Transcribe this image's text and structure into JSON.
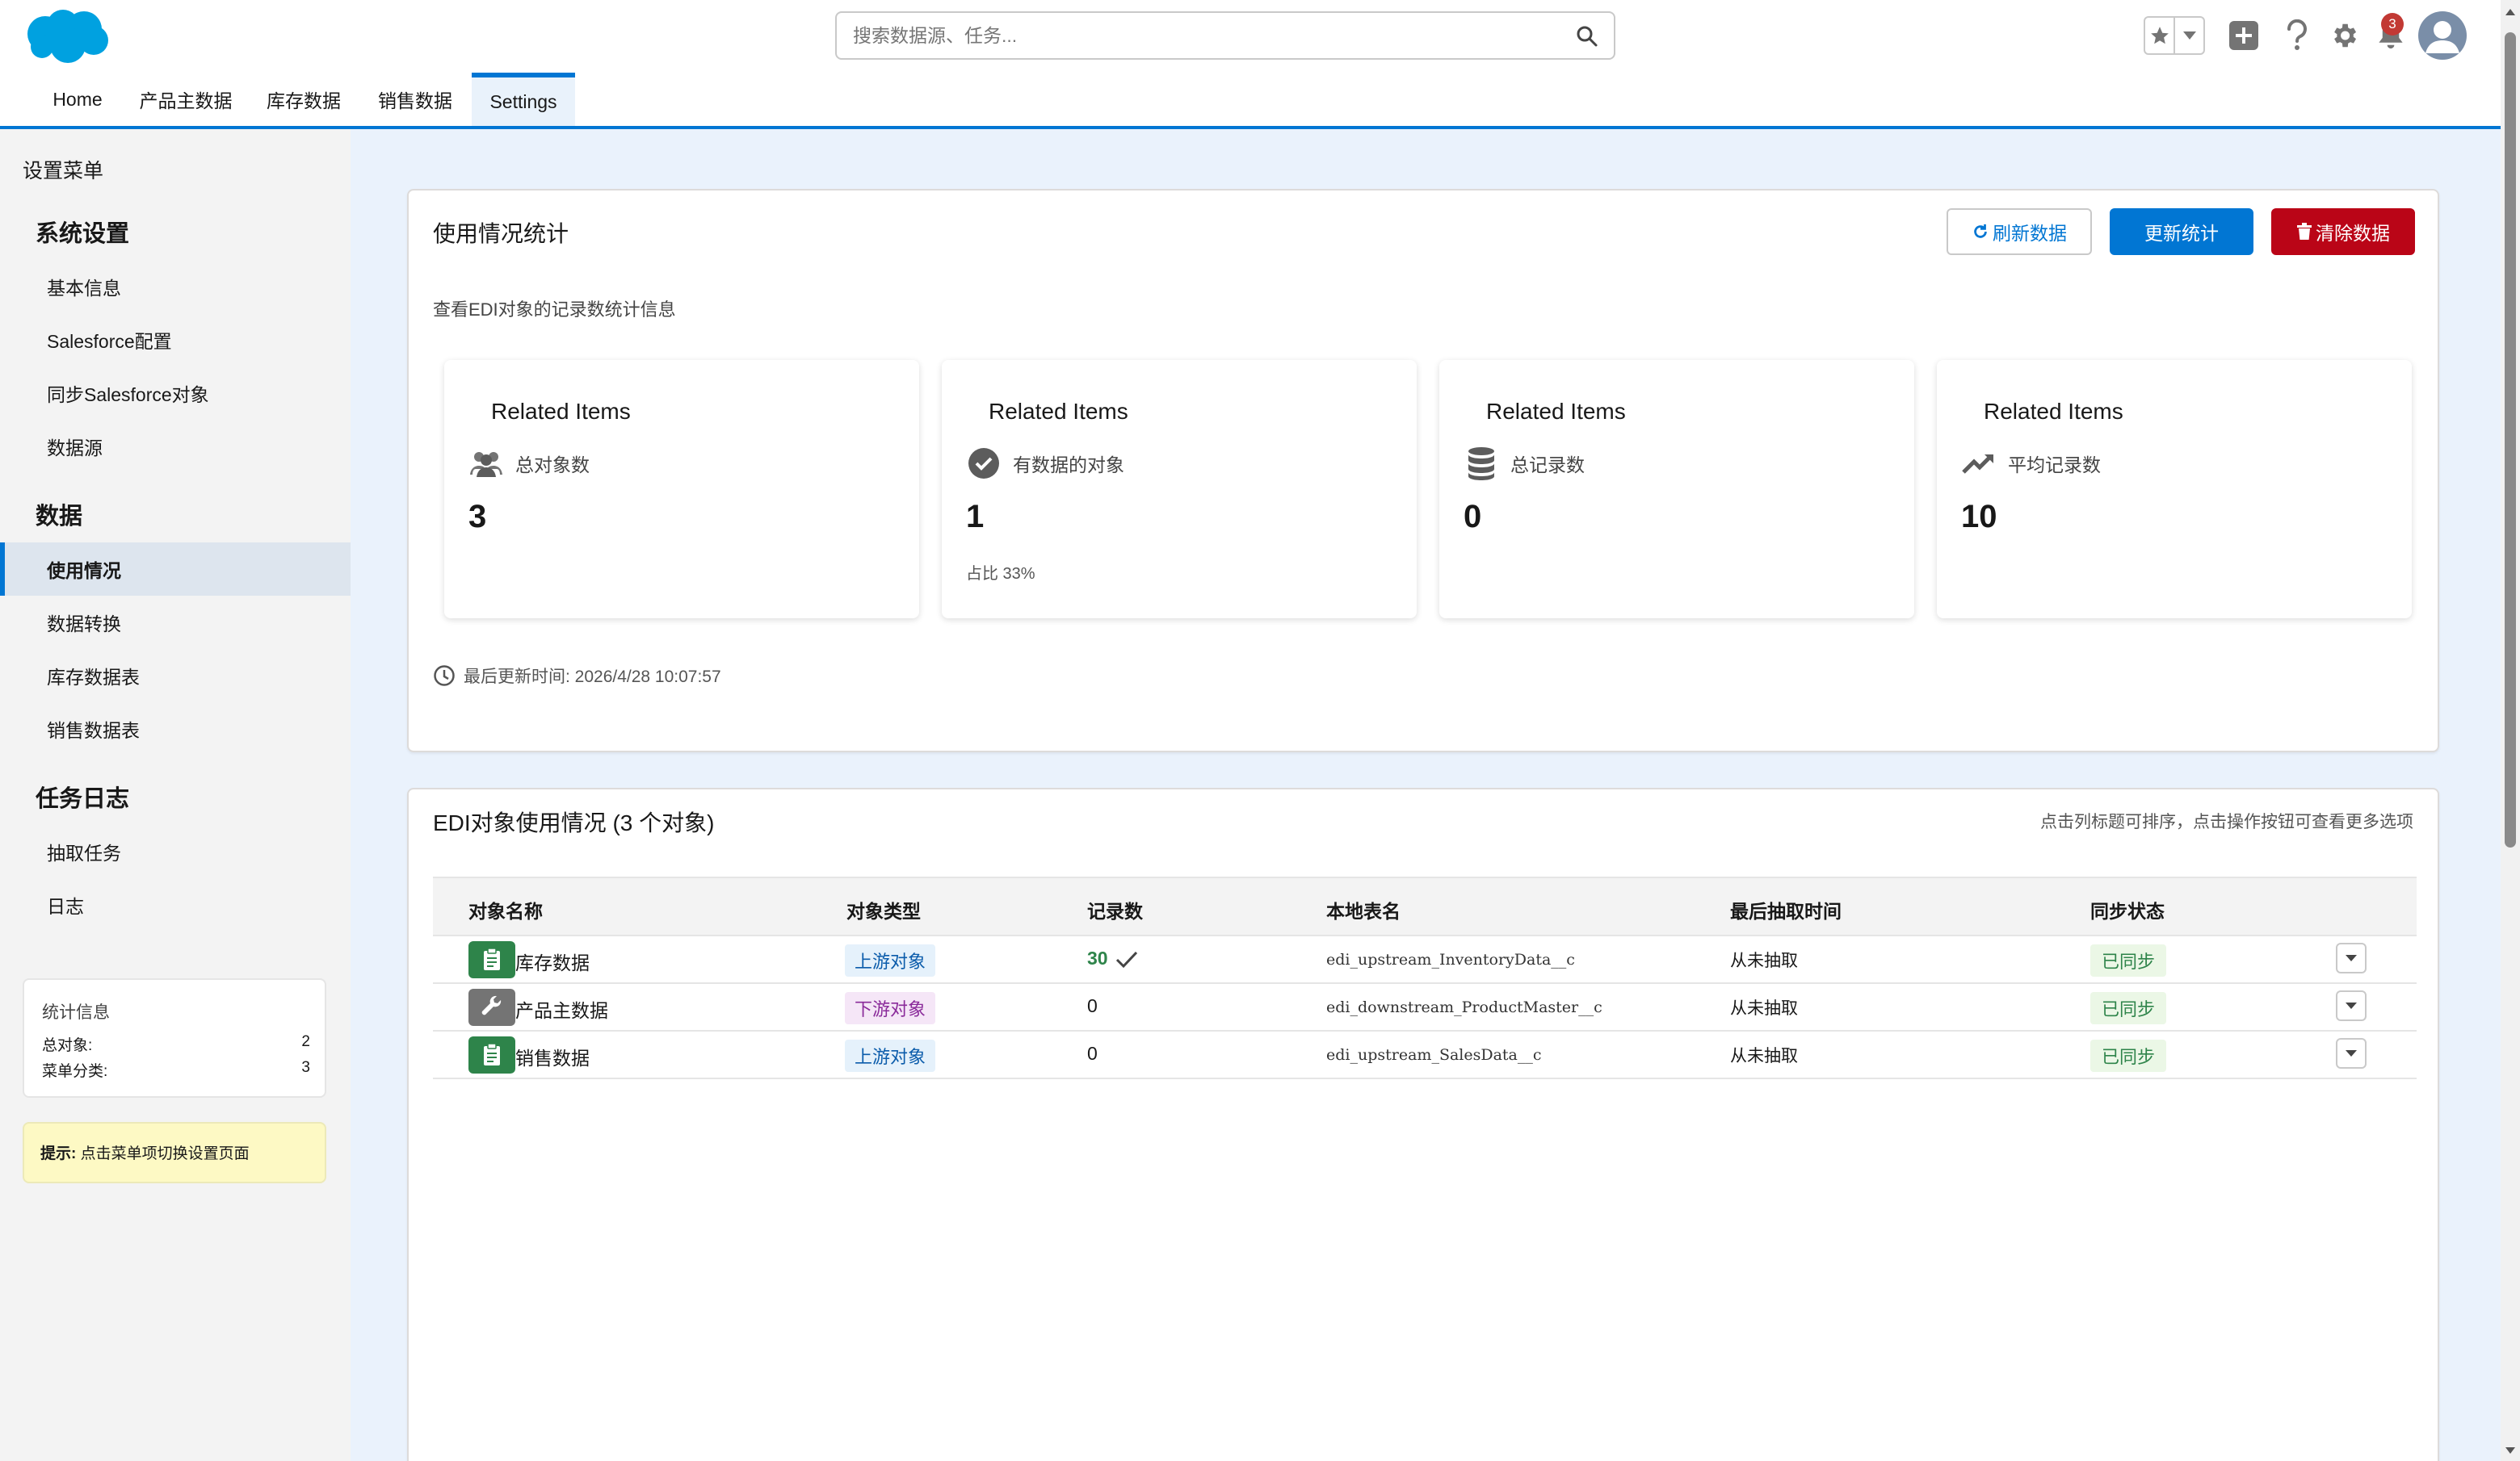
{
  "header": {
    "search_placeholder": "搜索数据源、任务...",
    "notification_count": "3"
  },
  "nav": {
    "tabs": [
      {
        "label": "Home"
      },
      {
        "label": "产品主数据"
      },
      {
        "label": "库存数据"
      },
      {
        "label": "销售数据"
      },
      {
        "label": "Settings",
        "active": true
      }
    ]
  },
  "sidebar": {
    "title": "设置菜单",
    "sections": [
      {
        "title": "系统设置",
        "items": [
          "基本信息",
          "Salesforce配置",
          "同步Salesforce对象",
          "数据源"
        ]
      },
      {
        "title": "数据",
        "items": [
          "使用情况",
          "数据转换",
          "库存数据表",
          "销售数据表"
        ]
      },
      {
        "title": "任务日志",
        "items": [
          "抽取任务",
          "日志"
        ]
      }
    ],
    "active_item": "使用情况",
    "stats": {
      "title": "统计信息",
      "rows": [
        {
          "label": "总对象:",
          "value": "2"
        },
        {
          "label": "菜单分类:",
          "value": "3"
        }
      ]
    },
    "tip": {
      "prefix": "提示:",
      "text": " 点击菜单项切换设置页面"
    }
  },
  "usage": {
    "title": "使用情况统计",
    "subtitle": "查看EDI对象的记录数统计信息",
    "buttons": {
      "refresh": "刷新数据",
      "update": "更新统计",
      "clear": "清除数据"
    },
    "metrics": [
      {
        "heading": "Related Items",
        "label": "总对象数",
        "value": "3",
        "note": "",
        "icon": "users-icon"
      },
      {
        "heading": "Related Items",
        "label": "有数据的对象",
        "value": "1",
        "note": "占比 33%",
        "icon": "check-circle-icon"
      },
      {
        "heading": "Related Items",
        "label": "总记录数",
        "value": "0",
        "note": "",
        "icon": "database-icon"
      },
      {
        "heading": "Related Items",
        "label": "平均记录数",
        "value": "10",
        "note": "",
        "icon": "trend-up-icon"
      }
    ],
    "last_updated": "最后更新时间: 2026/4/28 10:07:57"
  },
  "objects": {
    "title": "EDI对象使用情况 (3 个对象)",
    "hint": "点击列标题可排序，点击操作按钮可查看更多选项",
    "columns": [
      "对象名称",
      "对象类型",
      "记录数",
      "本地表名",
      "最后抽取时间",
      "同步状态"
    ],
    "rows": [
      {
        "name": "库存数据",
        "type": "上游对象",
        "type_kind": "up",
        "records": "30",
        "records_highlight": true,
        "table": "edi_upstream_InventoryData__c",
        "last_extract": "从未抽取",
        "status": "已同步",
        "icon": "clipboard-icon",
        "icon_color": "#2e844a"
      },
      {
        "name": "产品主数据",
        "type": "下游对象",
        "type_kind": "down",
        "records": "0",
        "records_highlight": false,
        "table": "edi_downstream_ProductMaster__c",
        "last_extract": "从未抽取",
        "status": "已同步",
        "icon": "wrench-icon",
        "icon_color": "#747474"
      },
      {
        "name": "销售数据",
        "type": "上游对象",
        "type_kind": "up",
        "records": "0",
        "records_highlight": false,
        "table": "edi_upstream_SalesData__c",
        "last_extract": "从未抽取",
        "status": "已同步",
        "icon": "clipboard-icon",
        "icon_color": "#2e844a"
      }
    ]
  }
}
